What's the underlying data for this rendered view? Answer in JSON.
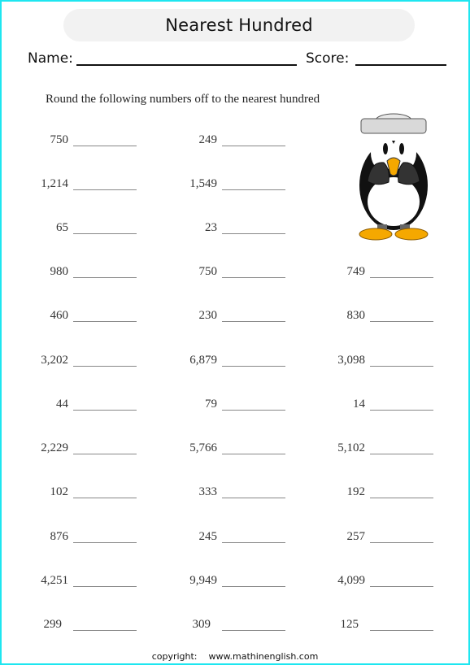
{
  "header": {
    "title": "Nearest Hundred",
    "name_label": "Name:",
    "score_label": "Score:"
  },
  "instructions": "Round the following numbers off to the nearest hundred",
  "columns": [
    [
      "750",
      "1,214",
      "65",
      "980",
      "460",
      "3,202",
      "44",
      "2,229",
      "102",
      "876",
      "4,251",
      "299"
    ],
    [
      "249",
      "1,549",
      "23",
      "750",
      "230",
      "6,879",
      "79",
      "5,766",
      "333",
      "245",
      "9,949",
      "309"
    ],
    [
      "749",
      "830",
      "3,098",
      "14",
      "5,102",
      "192",
      "257",
      "4,099",
      "125"
    ]
  ],
  "illustration": {
    "icon": "penguin-icon",
    "colors": {
      "beak": "#f5a800",
      "hat": "#d9d9d9",
      "body": "#111111"
    }
  },
  "footer": {
    "copyright_label": "copyright:",
    "url": "www.mathinenglish.com"
  },
  "colors": {
    "border": "#1ee6f0",
    "title_bg": "#f2f2f2"
  }
}
